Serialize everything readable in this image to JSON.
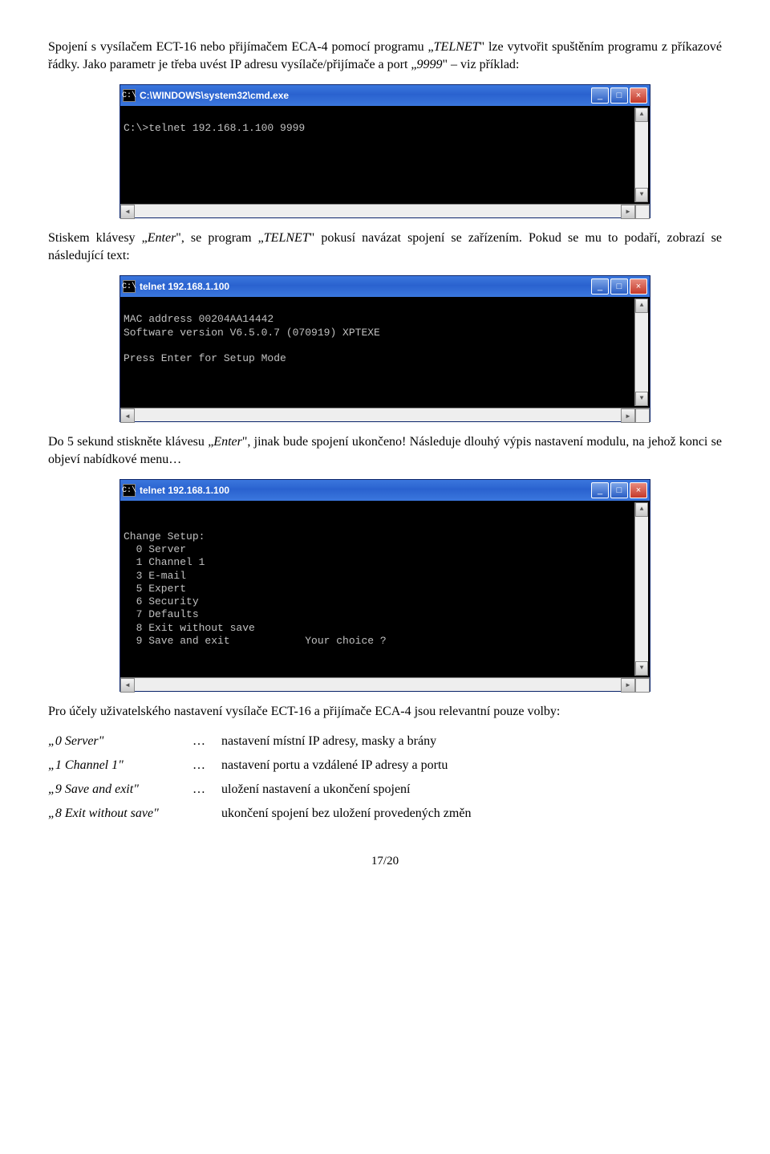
{
  "para1_a": "Spojení s vysílačem ECT-16 nebo přijímačem ECA-4 pomocí programu „",
  "para1_b": "TELNET",
  "para1_c": "\" lze vytvořit spuštěním programu z příkazové řádky. Jako parametr je třeba uvést IP adresu vysílače/přijímače a port „",
  "para1_d": "9999",
  "para1_e": "\" – viz příklad:",
  "win1": {
    "title": "C:\\WINDOWS\\system32\\cmd.exe",
    "lines": [
      "C:\\>telnet 192.168.1.100 9999",
      "",
      "",
      "",
      ""
    ]
  },
  "para2_a": "Stiskem klávesy „",
  "para2_b": "Enter",
  "para2_c": "\", se program „",
  "para2_d": "TELNET",
  "para2_e": "\" pokusí navázat spojení se zařízením. Pokud se mu to podaří, zobrazí se následující text:",
  "win2": {
    "title": "telnet 192.168.1.100",
    "lines": [
      "MAC address 00204AA14442",
      "Software version V6.5.0.7 (070919) XPTEXE",
      "",
      "Press Enter for Setup Mode",
      "",
      ""
    ]
  },
  "para3_a": "Do 5 sekund stiskněte klávesu „",
  "para3_b": "Enter",
  "para3_c": "\", jinak bude spojení ukončeno! Následuje dlouhý výpis nastavení modulu, na jehož konci se objeví nabídkové menu…",
  "win3": {
    "title": "telnet 192.168.1.100",
    "lines": [
      "",
      "Change Setup:",
      "  0 Server",
      "  1 Channel 1",
      "  3 E-mail",
      "  5 Expert",
      "  6 Security",
      "  7 Defaults",
      "  8 Exit without save",
      "  9 Save and exit            Your choice ?",
      ""
    ]
  },
  "para4": "Pro účely uživatelského nastavení vysílače ECT-16 a přijímače ECA-4 jsou relevantní pouze volby:",
  "defs": [
    {
      "key": "„0  Server\"",
      "sep": "…",
      "val": "nastavení místní IP adresy, masky a brány"
    },
    {
      "key": "„1  Channel 1\"",
      "sep": "…",
      "val": "nastavení portu a vzdálené IP adresy a portu"
    },
    {
      "key": "„9  Save and exit\"",
      "sep": "…",
      "val": "uložení nastavení a ukončení spojení"
    },
    {
      "key": "„8  Exit without save\"",
      "sep": "",
      "val": "ukončení spojení bez uložení provedených změn"
    }
  ],
  "footer": "17/20",
  "ui": {
    "sys_icon": "C:\\",
    "min": "_",
    "max": "□",
    "close": "×",
    "up": "▲",
    "down": "▼",
    "left": "◄",
    "right": "►"
  }
}
